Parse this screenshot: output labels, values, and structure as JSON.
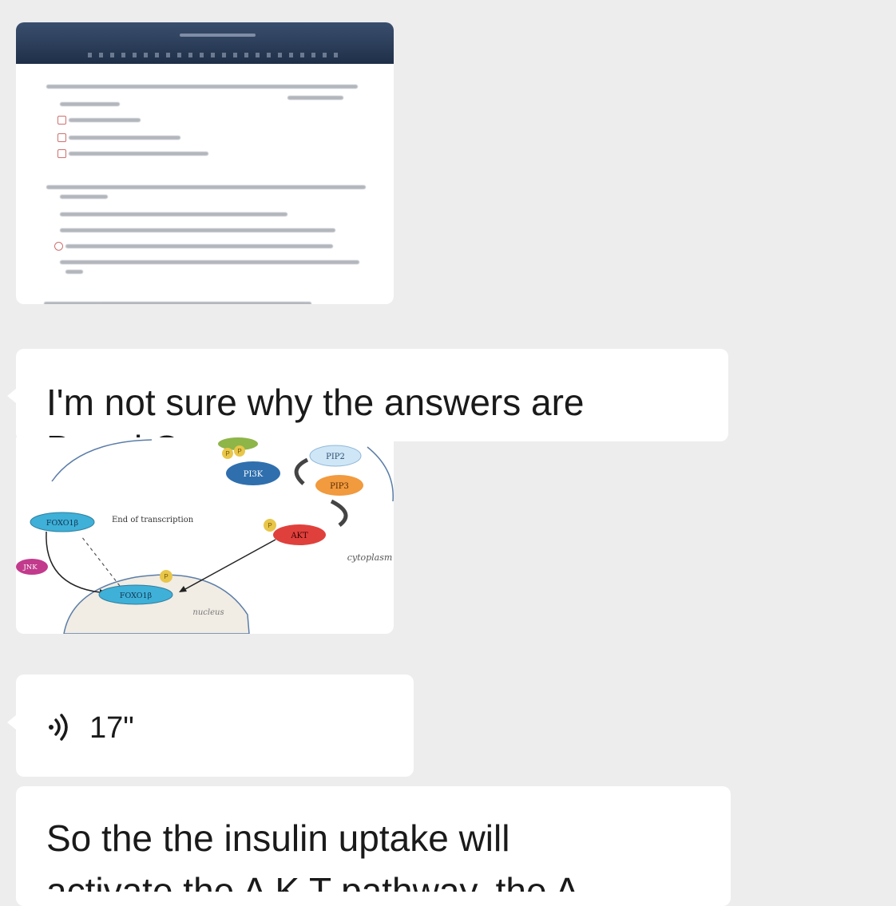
{
  "messages": {
    "question_line1": "I'm not sure why the answers are",
    "question_line2": "B and C",
    "voice_duration": "17\"",
    "reply_line1": "So the the insulin uptake will",
    "reply_line2": "activate the A K T pathway, the A"
  },
  "diagram": {
    "labels": {
      "pip2": "PIP2",
      "pip3": "PIP3",
      "pi3k": "PI3K",
      "akt": "AKT",
      "foxo_top": "FOXO1β",
      "foxo_bottom": "FOXO1β",
      "end_of_transcription": "End of transcription",
      "jnk": "JNK",
      "cytoplasm": "cytoplasm",
      "nucleus": "nucleus",
      "p": "P"
    },
    "colors": {
      "foxo": "#3fb0d8",
      "pi3k": "#2f6fae",
      "pip2": "#cfe6f7",
      "pip3": "#f19a3e",
      "akt": "#e0403c",
      "jnk": "#c23a8c",
      "phospho": "#e8c64a"
    }
  }
}
